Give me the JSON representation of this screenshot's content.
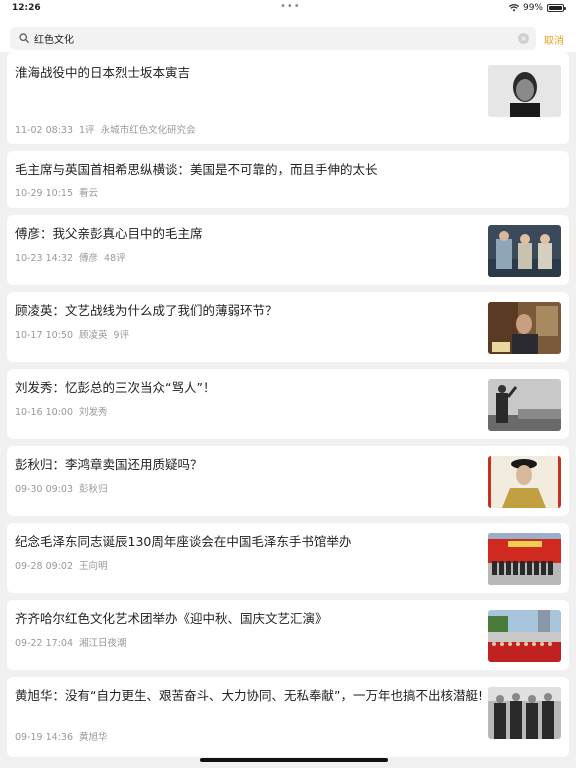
{
  "status_bar": {
    "time": "12:26",
    "dots": "•••",
    "battery": "99%",
    "battery_level": 0.99
  },
  "search": {
    "query": "红色文化",
    "placeholder": "",
    "clear_glyph": "×",
    "cancel_label": "取消"
  },
  "articles": [
    {
      "title": "淮海战役中的日本烈士坂本寅吉",
      "date": "11-02 08:33",
      "comments": "1评",
      "source": "永城市红色文化研究会",
      "thumbnail": "portrait-bw"
    },
    {
      "title": "毛主席与英国首相希思纵横谈：美国是不可靠的，而且手伸的太长",
      "date": "10-29 10:15",
      "comments": "",
      "source": "看云",
      "thumbnail": ""
    },
    {
      "title": "傅彦：我父亲彭真心目中的毛主席",
      "date": "10-23 14:32",
      "comments": "48评",
      "source": "傅彦",
      "thumbnail": "group-color"
    },
    {
      "title": "顾凌英：文艺战线为什么成了我们的薄弱环节？",
      "date": "10-17 10:50",
      "comments": "9评",
      "source": "顾凌英",
      "thumbnail": "speaker"
    },
    {
      "title": "刘发秀：忆彭总的三次当众“骂人”！",
      "date": "10-16 10:00",
      "comments": "",
      "source": "刘发秀",
      "thumbnail": "statue-bw"
    },
    {
      "title": "彭秋归：李鸿章卖国还用质疑吗？",
      "date": "09-30 09:03",
      "comments": "",
      "source": "彭秋归",
      "thumbnail": "qing-portrait"
    },
    {
      "title": "纪念毛泽东同志诞辰130周年座谈会在中国毛泽东手书馆举办",
      "date": "09-28 09:02",
      "comments": "",
      "source": "王向明",
      "thumbnail": "group-red"
    },
    {
      "title": "齐齐哈尔红色文化艺术团举办《迎中秋、国庆文艺汇演》",
      "date": "09-22 17:04",
      "comments": "",
      "source": "湘江日夜潮",
      "thumbnail": "crowd-outdoor"
    },
    {
      "title": "黄旭华：没有“自力更生、艰苦奋斗、大力协同、无私奉献”，一万年也搞不出核潜艇!",
      "date": "09-19 14:36",
      "comments": "",
      "source": "黄旭华",
      "thumbnail": "group-bw"
    }
  ]
}
